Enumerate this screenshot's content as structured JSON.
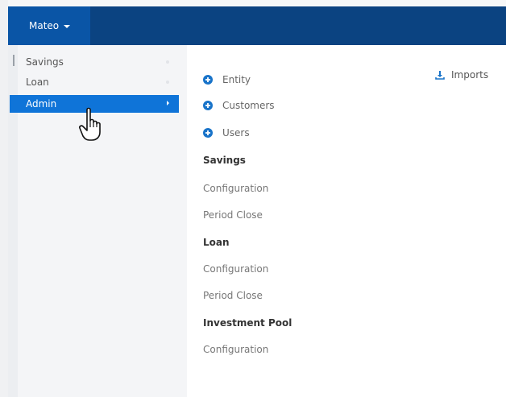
{
  "header": {
    "user_menu_label": "Mateo"
  },
  "sidebar": {
    "items": [
      {
        "label": "Savings"
      },
      {
        "label": "Loan"
      },
      {
        "label": "Admin"
      }
    ]
  },
  "admin_menu": {
    "quick_links": [
      {
        "label": "Entity",
        "icon": "plus-circle-icon"
      },
      {
        "label": "Customers",
        "icon": "plus-circle-icon"
      },
      {
        "label": "Users",
        "icon": "plus-circle-icon"
      }
    ],
    "sections": [
      {
        "title": "Savings",
        "links": [
          "Configuration",
          "Period Close"
        ]
      },
      {
        "title": "Loan",
        "links": [
          "Configuration",
          "Period Close"
        ]
      },
      {
        "title": "Investment Pool",
        "links": [
          "Configuration"
        ]
      }
    ],
    "imports_label": "Imports",
    "imports_icon": "download-icon"
  },
  "colors": {
    "topbar": "#0b4381",
    "user_menu": "#0a55a6",
    "active_item": "#0f74d8",
    "icon_blue": "#1873c9"
  }
}
